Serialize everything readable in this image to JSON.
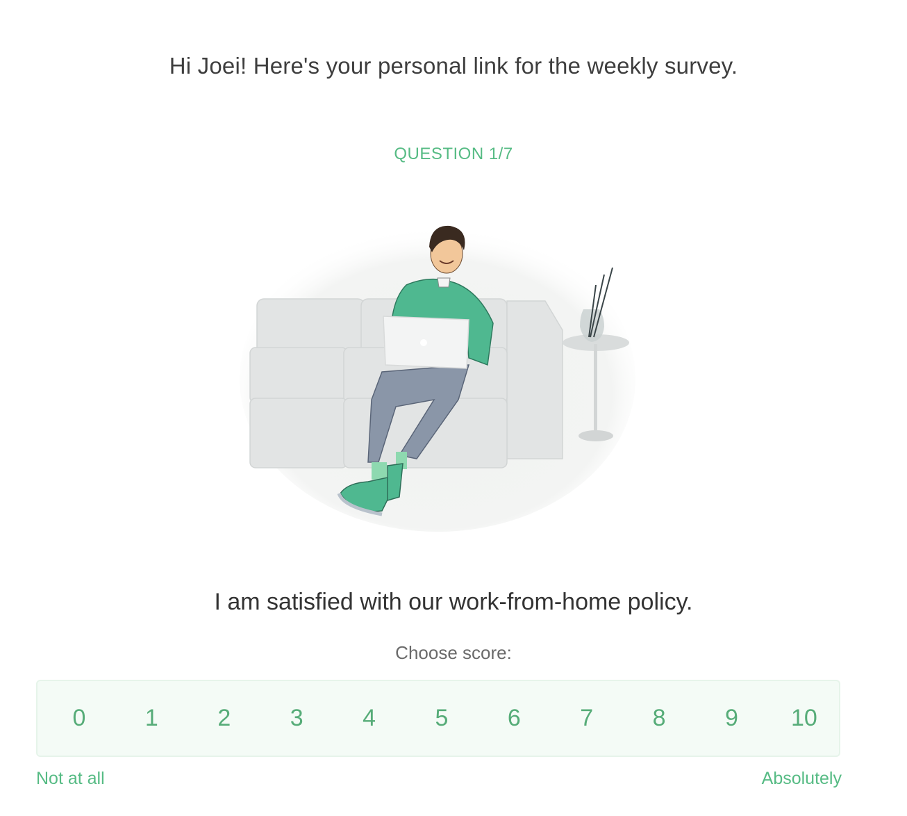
{
  "header": {
    "greeting": "Hi Joei! Here's your personal link for the weekly survey."
  },
  "survey": {
    "counter": "QUESTION 1/7",
    "illustration": "person-on-sofa-with-laptop-illustration",
    "question": "I am satisfied with our work-from-home policy.",
    "choose_label": "Choose score:",
    "scores": [
      "0",
      "1",
      "2",
      "3",
      "4",
      "5",
      "6",
      "7",
      "8",
      "9",
      "10"
    ],
    "min_label": "Not at all",
    "max_label": "Absolutely"
  },
  "colors": {
    "accent": "#56bb84",
    "score_text": "#56ac78",
    "score_box_bg": "#f4fbf6",
    "text_dark": "#333333"
  }
}
